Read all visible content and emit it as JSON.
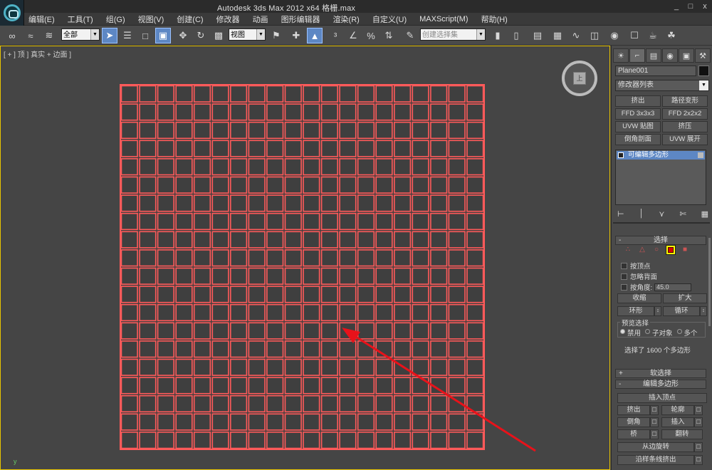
{
  "window": {
    "title": "Autodesk 3ds Max  2012 x64      格栅.max",
    "controls": [
      "_",
      "□",
      "x"
    ]
  },
  "menu": [
    "编辑(E)",
    "工具(T)",
    "组(G)",
    "视图(V)",
    "创建(C)",
    "修改器",
    "动画",
    "图形编辑器",
    "渲染(R)",
    "自定义(U)",
    "MAXScript(M)",
    "帮助(H)"
  ],
  "toolbar": {
    "selection_filter": "全部",
    "reference_coord": "视图",
    "named_selection": "创建选择集"
  },
  "viewport": {
    "label": "[ + ] 顶 ] 真实 + 边面 ]",
    "viewcube_face": "上",
    "axis_y": "y",
    "grid": {
      "rows": 20,
      "cols": 20
    },
    "grid_color": "#ff5a5a",
    "cell_fill": "#3f3f3f",
    "arrow_color": "#e8121a"
  },
  "panel": {
    "tabs": [
      "create-icon",
      "modify-icon",
      "hierarchy-icon",
      "motion-icon",
      "display-icon",
      "utilities-icon"
    ],
    "object_name": "Plane001",
    "modifier_list": "修改器列表",
    "modifier_buttons": [
      "挤出",
      "路径变形",
      "FFD 3x3x3",
      "FFD 2x2x2",
      "UVW 贴图",
      "挤压",
      "倒角剖面",
      "UVW 展开"
    ],
    "stack_item": "可编辑多边形",
    "selection": {
      "header": "选择",
      "by_vertex": "按顶点",
      "ignore_backface": "忽略背面",
      "by_angle": "按角度:",
      "angle_value": "45.0",
      "shrink": "收缩",
      "grow": "扩大",
      "ring": "环形",
      "loop": "循环",
      "preview_title": "预览选择",
      "preview_off": "禁用",
      "preview_subobj": "子对象",
      "preview_multi": "多个",
      "info": "选择了 1600 个多边形"
    },
    "soft_selection": "软选择",
    "edit_polygons": {
      "header": "编辑多边形",
      "insert_vertex": "插入顶点",
      "extrude": "挤出",
      "outline": "轮廓",
      "bevel": "倒角",
      "inset": "插入",
      "bridge": "桥",
      "flip": "翻转",
      "hinge": "从边旋转",
      "extrude_along_spline": "沿样条线挤出"
    }
  }
}
